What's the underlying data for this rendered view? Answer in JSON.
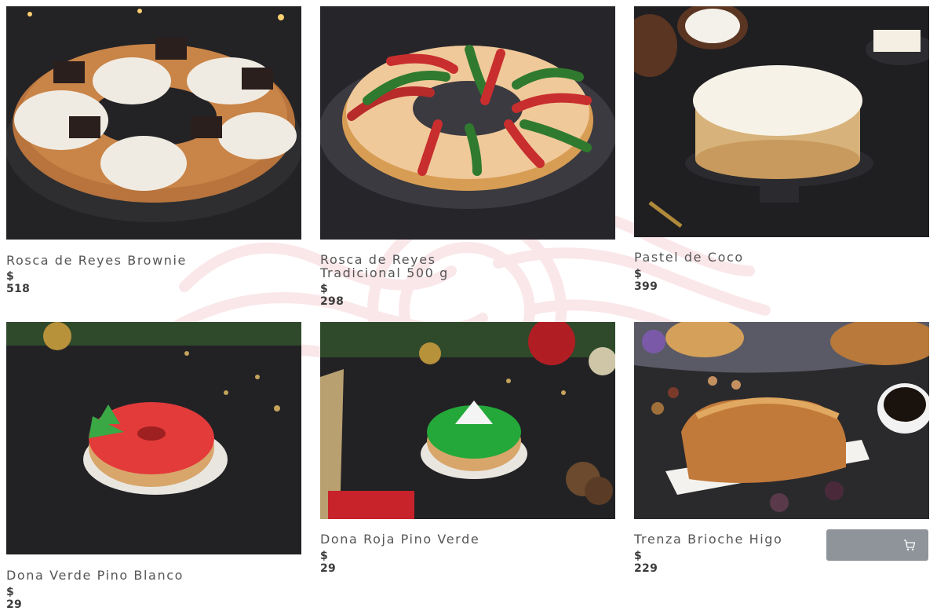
{
  "products": [
    {
      "name": "Rosca de Reyes Brownie",
      "price": "$ 518",
      "image_icon": "rosca-brownie-image"
    },
    {
      "name": "Rosca de Reyes Tradicional 500 g",
      "name_line1": "Rosca de Reyes",
      "name_line2": "Tradicional 500 g",
      "price": "$ 298",
      "image_icon": "rosca-tradicional-image"
    },
    {
      "name": "Pastel de Coco",
      "price": "$ 399",
      "image_icon": "pastel-coco-image"
    },
    {
      "name": "Dona Verde Pino Blanco",
      "price": "$ 29",
      "image_icon": "red-donut-image"
    },
    {
      "name": "Dona Roja Pino Verde",
      "price": "$ 29",
      "image_icon": "green-donut-image"
    },
    {
      "name": "Trenza Brioche Higo",
      "price": "$ 229",
      "image_icon": "brioche-image"
    }
  ],
  "cart_button": {
    "icon": "cart-icon"
  },
  "colors": {
    "background": "#ffffff",
    "watermark": "#f6d6da",
    "button": "#8e9499",
    "text": "#555555"
  }
}
